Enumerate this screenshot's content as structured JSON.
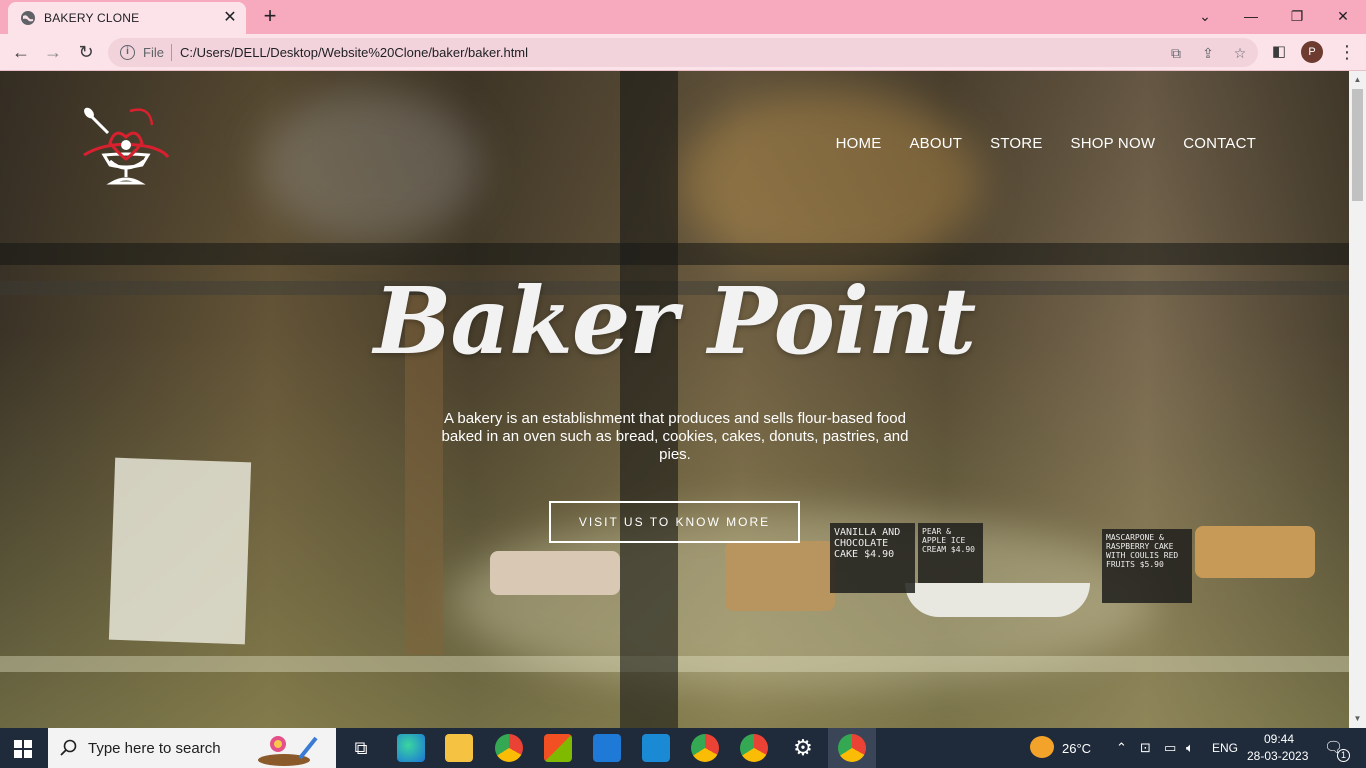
{
  "browser": {
    "tab_title": "BAKERY CLONE",
    "url_scheme_label": "File",
    "url": "C:/Users/DELL/Desktop/Website%20Clone/baker/baker.html",
    "profile_initial": "P"
  },
  "site": {
    "nav": [
      "HOME",
      "ABOUT",
      "STORE",
      "SHOP NOW",
      "CONTACT"
    ],
    "hero_title": "Baker Point",
    "hero_description": "A bakery is an establishment that produces and sells flour-based food baked in an oven such as bread, cookies, cakes, donuts, pastries, and pies.",
    "cta_label": "VISIT US TO KNOW MORE",
    "sign_1": "VANILLA AND CHOCOLATE CAKE $4.90",
    "sign_2": "PEAR & APPLE ICE CREAM $4.90",
    "sign_3": "MASCARPONE & RASPBERRY CAKE WITH COULIS RED FRUITS $5.90"
  },
  "taskbar": {
    "search_placeholder": "Type here to search",
    "weather": "26°C",
    "language": "ENG",
    "time": "09:44",
    "date": "28-03-2023",
    "notification_count": "1"
  },
  "colors": {
    "tabbar": "#f7a9bd",
    "toolbar": "#fce3ea",
    "taskbar": "#1f2a3a",
    "logo_accent": "#d8202f"
  }
}
